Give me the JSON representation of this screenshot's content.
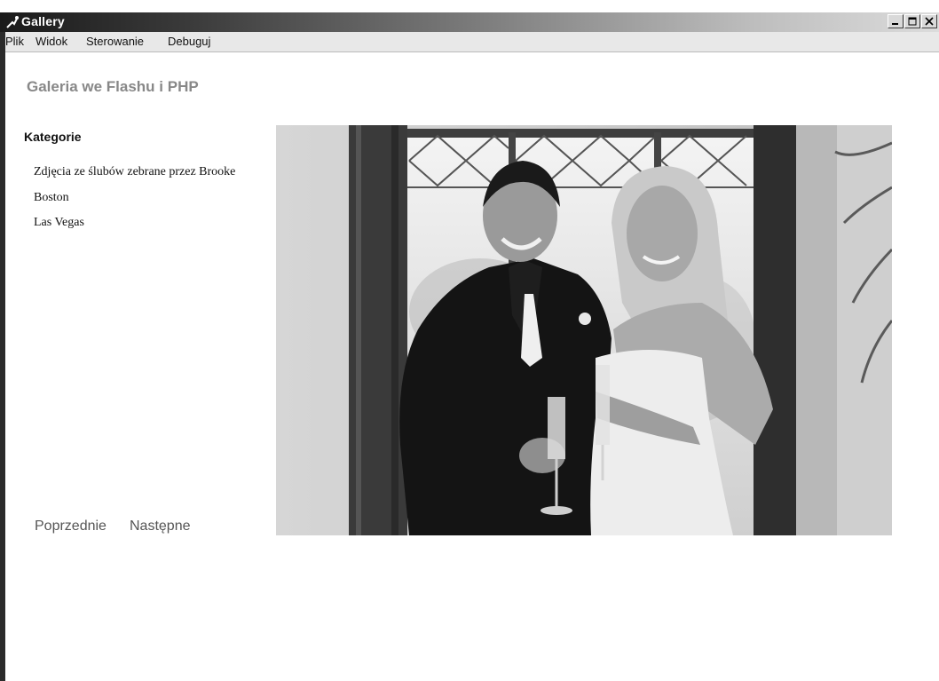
{
  "window": {
    "title": "Gallery",
    "controls": [
      "minimize",
      "maximize",
      "close"
    ]
  },
  "menu": [
    "Plik",
    "Widok",
    "Sterowanie",
    "Debuguj"
  ],
  "app": {
    "heading": "Galeria we Flashu i PHP"
  },
  "sidebar": {
    "heading": "Kategorie",
    "categories": [
      "Zdjęcia ze ślubów zebrane przez Brooke",
      "Boston",
      "Las Vegas"
    ]
  },
  "navigation": {
    "prev": "Poprzednie",
    "next": "Następne"
  },
  "photo": {
    "subject": "wedding couple holding champagne glasses in front of window"
  }
}
